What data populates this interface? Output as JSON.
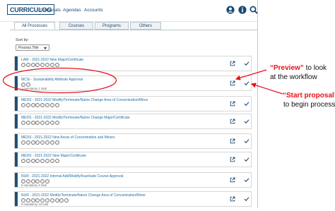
{
  "header": {
    "logo": "CURRICULOG",
    "nav": [
      "Proposals",
      "Agendas",
      "Accounts"
    ]
  },
  "tabs": [
    "All Processes",
    "Courses",
    "Programs",
    "Others"
  ],
  "sort": {
    "label": "Sort by:",
    "value": "Process Title"
  },
  "rows": [
    {
      "title": "LAW - 2021-2022 New Major/Certificate",
      "dots": 8,
      "meta": ""
    },
    {
      "title": "MCSI - Sustainability Attribute Approval",
      "dots": 2,
      "meta": "1 mandatory 1 total"
    },
    {
      "title": "MEDS - 2021-2022 Modify/Terminate/Name Change Area of Concentration/Minor",
      "dots": 8,
      "meta": ""
    },
    {
      "title": "MEDS - 2021-2022 Modify/Terminate/Name Change Major/Certificate",
      "dots": 8,
      "meta": ""
    },
    {
      "title": "MEDS - 2021-2022 New Areas of Concentration and Minors",
      "dots": 8,
      "meta": ""
    },
    {
      "title": "MEDS - 2021-2022 New Major/Certificate",
      "dots": 8,
      "meta": ""
    },
    {
      "title": "NUR - 2021-2022 Internal Add/Modify/Inactivate Course Approval",
      "dots": 6,
      "meta": "5 mandatory 6 total"
    },
    {
      "title": "NUR - 2021-2022 Modify/Terminate/Name Change Area of Concentration/Minor",
      "dots": 10,
      "meta": "9 mandatory 10 total"
    }
  ],
  "annotations": {
    "preview_red": "“Preview”",
    "preview_rest": " to look",
    "preview_line2": "at the workflow",
    "start_red": "“Start proposal”",
    "start_line2": "to begin process"
  },
  "colors": {
    "accent": "#1f4f7a",
    "link": "#1c6fa8",
    "highlight": "#e8101c"
  },
  "icons": {
    "account": "user-circle-icon",
    "info": "info-icon",
    "search": "search-icon",
    "preview": "external-link-icon",
    "start": "check-icon"
  }
}
